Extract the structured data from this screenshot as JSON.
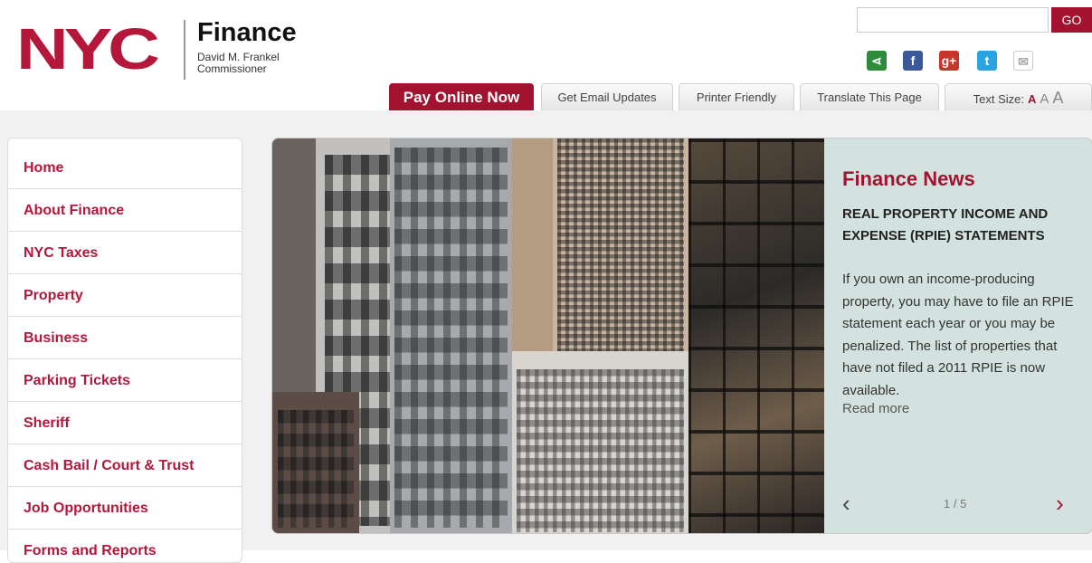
{
  "header": {
    "logo_text": "NYC",
    "title": "Finance",
    "commissioner_name": "David M. Frankel",
    "commissioner_role": "Commissioner"
  },
  "search": {
    "placeholder": "",
    "go_label": "GO"
  },
  "social": [
    {
      "name": "share-icon",
      "glyph": "⋖",
      "color": "#2e8b3a"
    },
    {
      "name": "facebook-icon",
      "glyph": "f",
      "color": "#3b5998"
    },
    {
      "name": "google-plus-icon",
      "glyph": "g+",
      "color": "#c8362b"
    },
    {
      "name": "twitter-icon",
      "glyph": "t",
      "color": "#2aa3e0"
    },
    {
      "name": "email-icon",
      "glyph": "✉",
      "color": "#bbbbbb"
    }
  ],
  "tabs": {
    "pay_online": "Pay Online Now",
    "email_updates": "Get Email Updates",
    "printer_friendly": "Printer Friendly",
    "translate": "Translate This Page",
    "text_size": "Text Size:",
    "size_small": "A",
    "size_medium": "A",
    "size_large": "A"
  },
  "sidebar": {
    "items": [
      {
        "label": "Home"
      },
      {
        "label": "About Finance"
      },
      {
        "label": "NYC Taxes"
      },
      {
        "label": "Property"
      },
      {
        "label": "Business"
      },
      {
        "label": "Parking Tickets"
      },
      {
        "label": "Sheriff"
      },
      {
        "label": "Cash Bail / Court & Trust"
      },
      {
        "label": "Job Opportunities"
      },
      {
        "label": "Forms and Reports"
      }
    ]
  },
  "news": {
    "title": "Finance News",
    "headline": "REAL PROPERTY INCOME AND EXPENSE (RPIE) STATEMENTS",
    "body": "If you own an income-producing property, you may have to file an RPIE statement each year or you may be penalized. The list of properties that have not filed a 2011 RPIE is now available.",
    "read_more": "Read more",
    "prev": "‹",
    "next": "›",
    "counter": "1 / 5"
  },
  "colors": {
    "brand": "#a3122f",
    "nav_text": "#b5173b",
    "news_panel": "#d3e2df"
  }
}
